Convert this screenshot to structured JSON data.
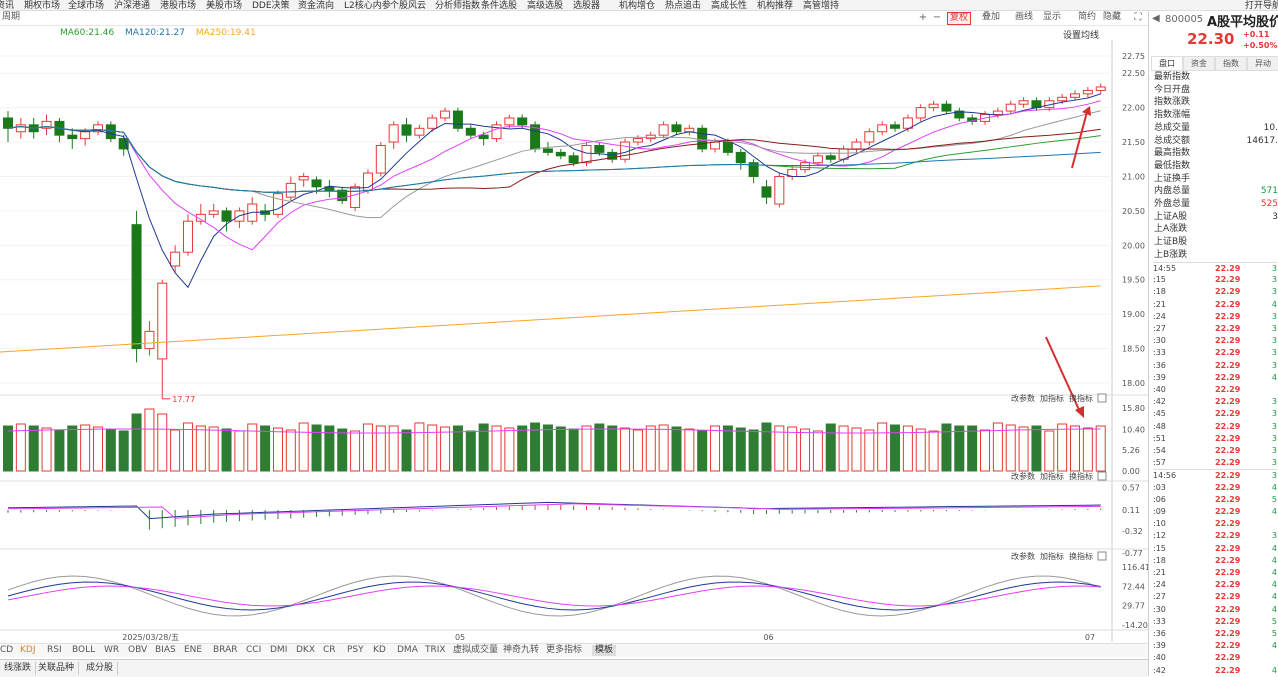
{
  "top_menu": [
    "资讯",
    "期权市场",
    "全球市场",
    "沪深港通",
    "港股市场",
    "美股市场",
    "DDE决策",
    "资金流向",
    "L2核心内参",
    "个股风云",
    "分析师指数",
    "条件选股",
    "高级选股",
    "选股器",
    "机构增仓",
    "热点追击",
    "高成长性",
    "机构推荐",
    "高管增持",
    "打开导航"
  ],
  "toolbar": {
    "left_label": "周期",
    "buttons": [
      "复权",
      "叠加",
      "画线",
      "显示",
      "简约",
      "隐藏"
    ]
  },
  "ma_legend": [
    {
      "label": "MA60:21.46",
      "color": "#2ca02c"
    },
    {
      "label": "MA120:21.27",
      "color": "#1f77b4"
    },
    {
      "label": "MA250:19.41",
      "color": "#f5a623"
    }
  ],
  "settings_label": "设置均线",
  "panel_buttons": {
    "params": "改参数",
    "add": "加指标",
    "swap": "换指标"
  },
  "price_axis": [
    "22.75",
    "22.50",
    "22.00",
    "21.50",
    "21.00",
    "20.50",
    "20.00",
    "19.50",
    "19.00",
    "18.50",
    "18.00"
  ],
  "vol_axis": [
    "15.80",
    "10.40",
    "5.26",
    "0.00"
  ],
  "macd_axis": [
    "0.57",
    "0.11",
    "-0.32",
    "-0.77"
  ],
  "kdj_axis": [
    "116.41",
    "72.44",
    "29.77",
    "-14.20"
  ],
  "low_annotation": "17.77",
  "date_axis": [
    {
      "label": "2025/03/28/五",
      "i": 12
    },
    {
      "label": "05",
      "i": 35
    },
    {
      "label": "06",
      "i": 59
    },
    {
      "label": "07",
      "i": 84
    }
  ],
  "indicator_tabs": [
    "CD",
    "KDJ",
    "RSI",
    "BOLL",
    "WR",
    "OBV",
    "BIAS",
    "ENE",
    "BRAR",
    "CCI",
    "DMI",
    "DKX",
    "CR",
    "PSY",
    "KD",
    "DMA",
    "TRIX",
    "虚拟成交量",
    "神奇九转",
    "更多指标",
    "模板"
  ],
  "bottom_tabs": [
    "线涨跌",
    "关联品种",
    "成分股"
  ],
  "quote": {
    "code": "800005",
    "name": "A股平均股价",
    "price": "22.30",
    "change": "+0.11",
    "change_pct": "+0.50%"
  },
  "right_tabs": [
    "盘口",
    "资金",
    "指数",
    "异动"
  ],
  "stats": [
    {
      "k": "最新指数",
      "v": ""
    },
    {
      "k": "今日开盘",
      "v": ""
    },
    {
      "k": "指数涨跌",
      "v": ""
    },
    {
      "k": "指数涨幅",
      "v": ""
    },
    {
      "k": "总成交量",
      "v": "10."
    },
    {
      "k": "总成交额",
      "v": "14617."
    },
    {
      "k": "最高指数",
      "v": ""
    },
    {
      "k": "最低指数",
      "v": ""
    },
    {
      "k": "上证换手",
      "v": ""
    },
    {
      "k": "内盘总量",
      "v": "571"
    },
    {
      "k": "外盘总量",
      "v": "525"
    },
    {
      "k": "上证A股",
      "v": "3"
    },
    {
      "k": "上A涨跌",
      "v": ""
    },
    {
      "k": "上证B股",
      "v": ""
    },
    {
      "k": "上B涨跌",
      "v": ""
    }
  ],
  "ticks": [
    {
      "t": "14:55",
      "p": "22.29",
      "q": "3"
    },
    {
      "t": ":15",
      "p": "22.29",
      "q": "3"
    },
    {
      "t": ":18",
      "p": "22.29",
      "q": "3"
    },
    {
      "t": ":21",
      "p": "22.29",
      "q": "4"
    },
    {
      "t": ":24",
      "p": "22.29",
      "q": "3"
    },
    {
      "t": ":27",
      "p": "22.29",
      "q": "3"
    },
    {
      "t": ":30",
      "p": "22.29",
      "q": "3"
    },
    {
      "t": ":33",
      "p": "22.29",
      "q": "3"
    },
    {
      "t": ":36",
      "p": "22.29",
      "q": "3"
    },
    {
      "t": ":39",
      "p": "22.29",
      "q": "4"
    },
    {
      "t": ":40",
      "p": "22.29",
      "q": ""
    },
    {
      "t": ":42",
      "p": "22.29",
      "q": "3"
    },
    {
      "t": ":45",
      "p": "22.29",
      "q": "3"
    },
    {
      "t": ":48",
      "p": "22.29",
      "q": "3"
    },
    {
      "t": ":51",
      "p": "22.29",
      "q": "3"
    },
    {
      "t": ":54",
      "p": "22.29",
      "q": "3"
    },
    {
      "t": ":57",
      "p": "22.29",
      "q": "3"
    },
    {
      "t": "14:56",
      "p": "22.29",
      "q": "3"
    },
    {
      "t": ":03",
      "p": "22.29",
      "q": "4"
    },
    {
      "t": ":06",
      "p": "22.29",
      "q": "5"
    },
    {
      "t": ":09",
      "p": "22.29",
      "q": "4"
    },
    {
      "t": ":10",
      "p": "22.29",
      "q": ""
    },
    {
      "t": ":12",
      "p": "22.29",
      "q": "3"
    },
    {
      "t": ":15",
      "p": "22.29",
      "q": "4"
    },
    {
      "t": ":18",
      "p": "22.29",
      "q": "4"
    },
    {
      "t": ":21",
      "p": "22.29",
      "q": "4"
    },
    {
      "t": ":24",
      "p": "22.29",
      "q": "4"
    },
    {
      "t": ":27",
      "p": "22.29",
      "q": "4"
    },
    {
      "t": ":30",
      "p": "22.29",
      "q": "4"
    },
    {
      "t": ":33",
      "p": "22.29",
      "q": "5"
    },
    {
      "t": ":36",
      "p": "22.29",
      "q": "5"
    },
    {
      "t": ":39",
      "p": "22.29",
      "q": "4"
    },
    {
      "t": ":40",
      "p": "22.29",
      "q": ""
    },
    {
      "t": ":42",
      "p": "22.29",
      "q": "4"
    }
  ],
  "chart_data": {
    "type": "candlestick",
    "price_range": [
      17.6,
      22.85
    ],
    "candles": [
      [
        21.85,
        21.7,
        21.95,
        21.5
      ],
      [
        21.65,
        21.75,
        21.85,
        21.55
      ],
      [
        21.75,
        21.65,
        21.85,
        21.55
      ],
      [
        21.7,
        21.8,
        21.9,
        21.6
      ],
      [
        21.8,
        21.6,
        21.85,
        21.5
      ],
      [
        21.6,
        21.55,
        21.7,
        21.4
      ],
      [
        21.55,
        21.65,
        21.7,
        21.45
      ],
      [
        21.65,
        21.75,
        21.8,
        21.6
      ],
      [
        21.75,
        21.55,
        21.8,
        21.5
      ],
      [
        21.55,
        21.4,
        21.6,
        21.3
      ],
      [
        20.3,
        18.5,
        20.5,
        18.3
      ],
      [
        18.5,
        18.75,
        18.9,
        18.4
      ],
      [
        18.35,
        19.45,
        19.5,
        17.77
      ],
      [
        19.7,
        19.9,
        20.0,
        19.6
      ],
      [
        19.9,
        20.35,
        20.45,
        19.85
      ],
      [
        20.35,
        20.45,
        20.6,
        20.3
      ],
      [
        20.45,
        20.5,
        20.6,
        20.4
      ],
      [
        20.5,
        20.35,
        20.55,
        20.2
      ],
      [
        20.35,
        20.5,
        20.55,
        20.25
      ],
      [
        20.35,
        20.6,
        20.7,
        20.3
      ],
      [
        20.5,
        20.45,
        20.6,
        20.35
      ],
      [
        20.45,
        20.75,
        20.8,
        20.4
      ],
      [
        20.7,
        20.9,
        21.0,
        20.65
      ],
      [
        20.95,
        21.0,
        21.05,
        20.85
      ],
      [
        20.95,
        20.85,
        21.0,
        20.75
      ],
      [
        20.85,
        20.8,
        20.95,
        20.7
      ],
      [
        20.8,
        20.65,
        20.85,
        20.6
      ],
      [
        20.55,
        20.85,
        20.9,
        20.5
      ],
      [
        20.8,
        21.05,
        21.1,
        20.75
      ],
      [
        21.05,
        21.45,
        21.5,
        21.0
      ],
      [
        21.5,
        21.75,
        21.8,
        21.4
      ],
      [
        21.75,
        21.6,
        21.85,
        21.5
      ],
      [
        21.6,
        21.7,
        21.75,
        21.55
      ],
      [
        21.7,
        21.85,
        21.9,
        21.65
      ],
      [
        21.85,
        21.95,
        22.0,
        21.8
      ],
      [
        21.95,
        21.7,
        22.0,
        21.65
      ],
      [
        21.7,
        21.6,
        21.75,
        21.55
      ],
      [
        21.6,
        21.55,
        21.65,
        21.45
      ],
      [
        21.55,
        21.75,
        21.8,
        21.5
      ],
      [
        21.75,
        21.85,
        21.9,
        21.7
      ],
      [
        21.85,
        21.75,
        21.9,
        21.7
      ],
      [
        21.75,
        21.4,
        21.8,
        21.35
      ],
      [
        21.4,
        21.35,
        21.5,
        21.3
      ],
      [
        21.35,
        21.3,
        21.4,
        21.25
      ],
      [
        21.3,
        21.2,
        21.35,
        21.15
      ],
      [
        21.2,
        21.45,
        21.5,
        21.15
      ],
      [
        21.45,
        21.35,
        21.5,
        21.3
      ],
      [
        21.35,
        21.25,
        21.4,
        21.2
      ],
      [
        21.25,
        21.5,
        21.55,
        21.2
      ],
      [
        21.5,
        21.55,
        21.6,
        21.45
      ],
      [
        21.55,
        21.6,
        21.65,
        21.5
      ],
      [
        21.6,
        21.75,
        21.8,
        21.55
      ],
      [
        21.75,
        21.65,
        21.8,
        21.6
      ],
      [
        21.65,
        21.7,
        21.75,
        21.6
      ],
      [
        21.7,
        21.4,
        21.75,
        21.35
      ],
      [
        21.4,
        21.5,
        21.55,
        21.35
      ],
      [
        21.5,
        21.35,
        21.55,
        21.3
      ],
      [
        21.35,
        21.2,
        21.4,
        21.1
      ],
      [
        21.2,
        21.0,
        21.25,
        20.9
      ],
      [
        20.85,
        20.7,
        20.95,
        20.6
      ],
      [
        20.6,
        21.0,
        21.05,
        20.55
      ],
      [
        21.0,
        21.1,
        21.15,
        20.95
      ],
      [
        21.1,
        21.2,
        21.25,
        21.05
      ],
      [
        21.2,
        21.3,
        21.35,
        21.15
      ],
      [
        21.3,
        21.25,
        21.35,
        21.2
      ],
      [
        21.25,
        21.4,
        21.45,
        21.2
      ],
      [
        21.4,
        21.5,
        21.55,
        21.35
      ],
      [
        21.5,
        21.65,
        21.7,
        21.45
      ],
      [
        21.65,
        21.75,
        21.8,
        21.6
      ],
      [
        21.75,
        21.7,
        21.8,
        21.65
      ],
      [
        21.7,
        21.85,
        21.9,
        21.65
      ],
      [
        21.85,
        22.0,
        22.05,
        21.8
      ],
      [
        22.0,
        22.05,
        22.1,
        21.95
      ],
      [
        22.05,
        21.95,
        22.1,
        21.9
      ],
      [
        21.95,
        21.85,
        22.0,
        21.8
      ],
      [
        21.85,
        21.8,
        21.9,
        21.75
      ],
      [
        21.8,
        21.9,
        21.95,
        21.75
      ],
      [
        21.9,
        21.95,
        22.0,
        21.85
      ],
      [
        21.95,
        22.05,
        22.1,
        21.9
      ],
      [
        22.05,
        22.1,
        22.15,
        22.0
      ],
      [
        22.1,
        22.0,
        22.15,
        21.95
      ],
      [
        22.0,
        22.1,
        22.15,
        21.95
      ],
      [
        22.1,
        22.15,
        22.2,
        22.05
      ],
      [
        22.15,
        22.2,
        22.25,
        22.1
      ],
      [
        22.2,
        22.25,
        22.3,
        22.15
      ],
      [
        22.25,
        22.3,
        22.35,
        22.2
      ]
    ]
  }
}
